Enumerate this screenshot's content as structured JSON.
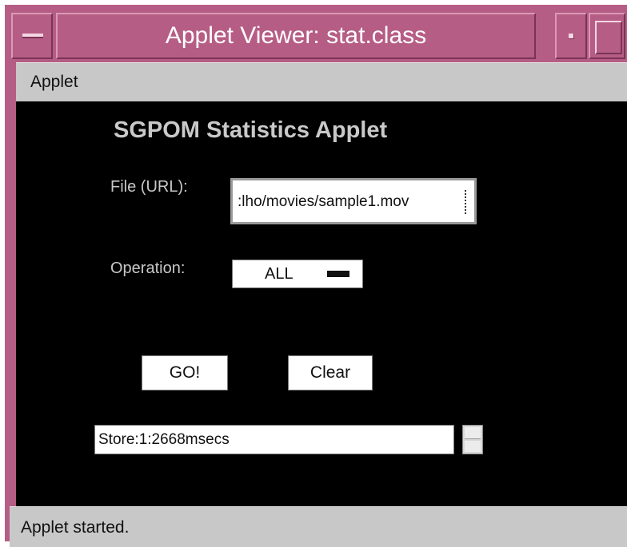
{
  "window": {
    "title": "Applet Viewer: stat.class",
    "frame_color": "#b65d85"
  },
  "menubar": {
    "items": [
      "Applet"
    ]
  },
  "applet": {
    "heading": "SGPOM Statistics Applet",
    "file_label": "File (URL):",
    "file_value": ":lho/movies/sample1.mov",
    "operation_label": "Operation:",
    "operation_value": "ALL",
    "go_label": "GO!",
    "clear_label": "Clear",
    "result_text": "Store:1:2668msecs"
  },
  "statusbar": {
    "text": "Applet started."
  }
}
